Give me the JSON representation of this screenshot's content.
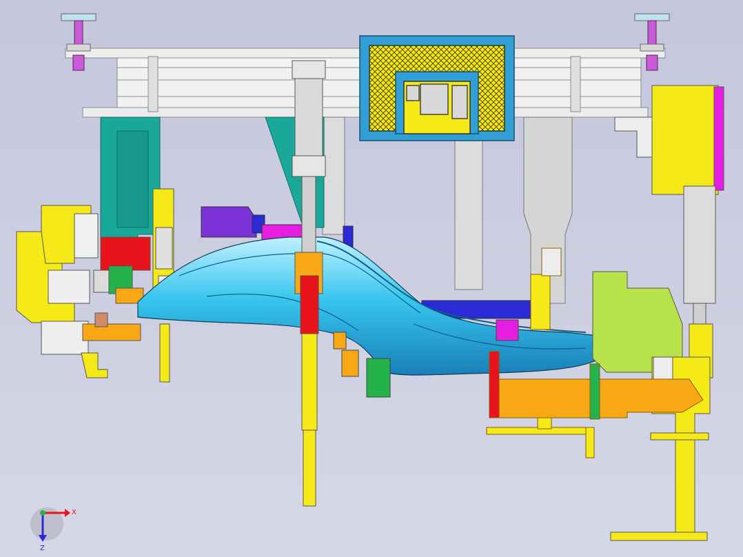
{
  "viewport": {
    "background_top": "#c4c6dc",
    "background_bottom": "#d6d7e6"
  },
  "colors": {
    "frame_gray": "#ededed",
    "frame_line": "#8a8a8a",
    "teal": "#1aa89b",
    "panel_blue": "#2f9fd6",
    "yellow": "#f5ea18",
    "orange": "#f7a814",
    "red": "#e8131b",
    "lime": "#b7e34a",
    "purple": "#7b33d8",
    "magenta": "#e51ee0",
    "part_cyan": "#33c2e8",
    "cylinder_gray": "#d9d9d9",
    "navy": "#2a2ad6",
    "green": "#26b24a"
  },
  "triad": {
    "x_label": "X",
    "z_label": "Z",
    "x_color": "#e8131b",
    "z_color": "#2a2ad6",
    "origin_color": "#26b24a"
  }
}
